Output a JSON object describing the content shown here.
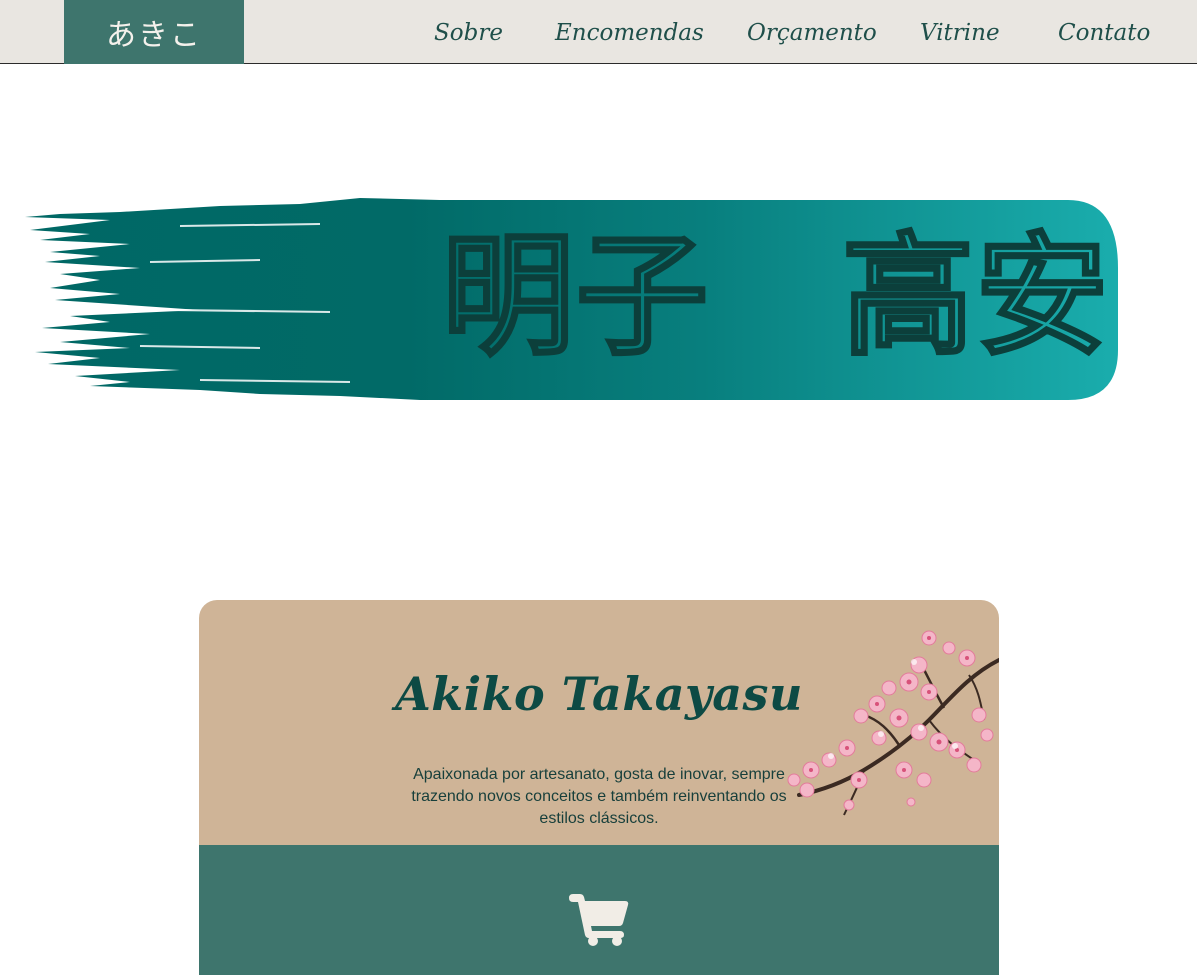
{
  "header": {
    "logo": "あきこ",
    "nav": [
      {
        "label": "Sobre"
      },
      {
        "label": "Encomendas"
      },
      {
        "label": "Orçamento"
      },
      {
        "label": "Vitrine"
      },
      {
        "label": "Contato"
      }
    ]
  },
  "hero": {
    "given_name_kanji": "明子",
    "family_name_kanji": "高安"
  },
  "profile": {
    "name": "Akiko Takayasu",
    "bio": "Apaixonada por artesanato, gosta de inovar, sempre trazendo novos conceitos e também reinventando os estilos clássicos.",
    "decoration_icon": "cherry-blossom-branch",
    "action_icon": "shopping-cart-icon"
  },
  "colors": {
    "nav_bg": "#e9e6e1",
    "accent_green": "#3e756d",
    "text_dark_green": "#1f4f4a",
    "brush_dark": "#006865",
    "brush_light": "#1aadad",
    "card_tan": "#cfb497",
    "cart_icon": "#f1ede6"
  }
}
